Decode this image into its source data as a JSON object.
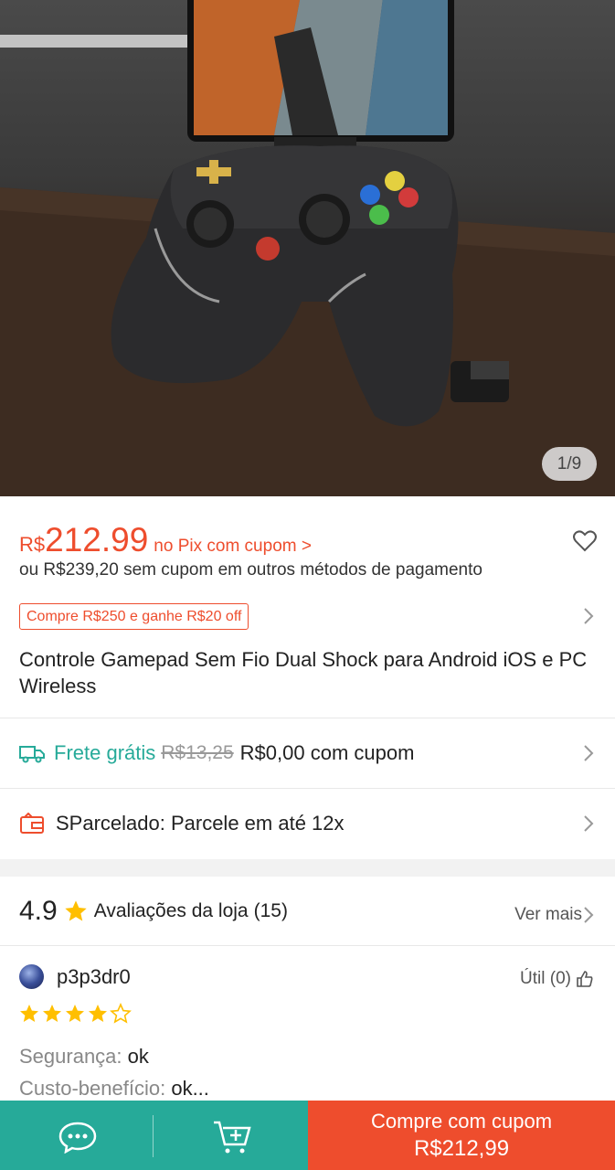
{
  "gallery": {
    "counter": "1/9"
  },
  "price": {
    "currency": "R$",
    "amount": "212.99",
    "pix_label": "no Pix com cupom >",
    "alt_price": "ou R$239,20 sem cupom em outros métodos de pagamento"
  },
  "voucher": {
    "label": "Compre R$250 e ganhe R$20 off"
  },
  "product": {
    "title": "Controle Gamepad Sem Fio Dual Shock para Android iOS e PC Wireless"
  },
  "shipping": {
    "label": "Frete grátis",
    "old_price": "R$13,25",
    "new_price": "R$0,00 com cupom"
  },
  "installments": {
    "label": "SParcelado: Parcele em até 12x"
  },
  "store_rating": {
    "score": "4.9",
    "label": "Avaliações da loja",
    "count": "(15)",
    "see_more": "Ver mais"
  },
  "review": {
    "username": "p3p3dr0",
    "helpful": "Útil (0)",
    "stars": 4,
    "lines": [
      {
        "key": "Segurança:",
        "value": "ok"
      },
      {
        "key": "Custo-benefício:",
        "value": "ok..."
      }
    ]
  },
  "bottom_bar": {
    "buy_line1": "Compre com cupom",
    "buy_line2": "R$212,99"
  },
  "colors": {
    "accent": "#ee4d2d",
    "teal": "#26aa99",
    "star": "#ffbf00"
  }
}
